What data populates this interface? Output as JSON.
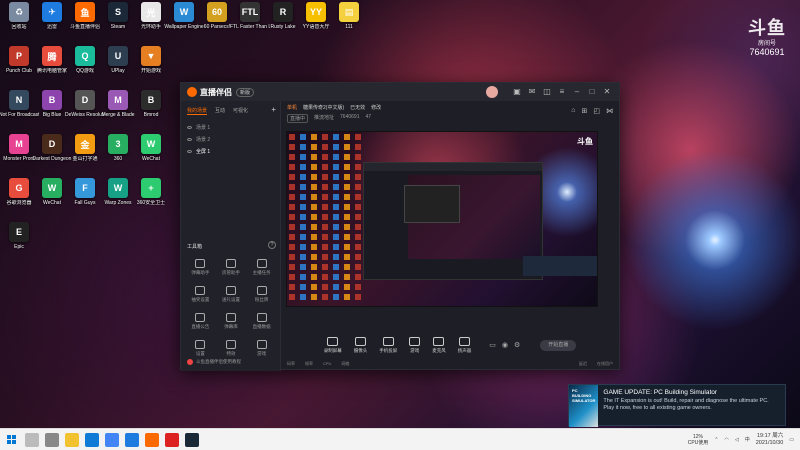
{
  "desktop_icons": [
    {
      "label": "回收站",
      "color": "#7a8aa0",
      "glyph": "♻"
    },
    {
      "label": "迅雷",
      "color": "#1e7be0",
      "glyph": "✈"
    },
    {
      "label": "斗鱼直播伴侣",
      "color": "#ff6a00",
      "glyph": "鱼"
    },
    {
      "label": "Steam",
      "color": "#1b2838",
      "glyph": "S"
    },
    {
      "label": "光环助手",
      "color": "#e8e8e8",
      "glyph": "光"
    },
    {
      "label": "Wallpaper Engine",
      "color": "#2a8ad4",
      "glyph": "W"
    },
    {
      "label": "60 Parsecs!",
      "color": "#d4a020",
      "glyph": "60"
    },
    {
      "label": "FTL Faster Than Light",
      "color": "#333",
      "glyph": "FTL"
    },
    {
      "label": "Rusty Lake",
      "color": "#222",
      "glyph": "R"
    },
    {
      "label": "YY语音大厅",
      "color": "#f6c000",
      "glyph": "YY"
    },
    {
      "label": "111",
      "color": "#f4d03f",
      "glyph": "▤"
    },
    {
      "label": "Punch Club",
      "color": "#c0392b",
      "glyph": "P"
    },
    {
      "label": "腾讯电脑管家",
      "color": "#e74c3c",
      "glyph": "腾"
    },
    {
      "label": "QQ游戏",
      "color": "#1abc9c",
      "glyph": "Q"
    },
    {
      "label": "UPlay",
      "color": "#2c3e50",
      "glyph": "U"
    },
    {
      "label": "开始游戏",
      "color": "#e67e22",
      "glyph": "▼"
    },
    {
      "label": "Not For Broadcast",
      "color": "#34495e",
      "glyph": "N"
    },
    {
      "label": "Big Blue",
      "color": "#8e44ad",
      "glyph": "B"
    },
    {
      "label": "DeWeiss Resolution",
      "color": "#555",
      "glyph": "D"
    },
    {
      "label": "Merge & Blade",
      "color": "#9b59b6",
      "glyph": "M"
    },
    {
      "label": "Bmrod",
      "color": "#2c2c2c",
      "glyph": "B"
    },
    {
      "label": "Monster Prom",
      "color": "#e84393",
      "glyph": "M"
    },
    {
      "label": "Darkest Dungeon",
      "color": "#4a2a1a",
      "glyph": "D"
    },
    {
      "label": "金山打字通",
      "color": "#f39c12",
      "glyph": "金"
    },
    {
      "label": "360",
      "color": "#27ae60",
      "glyph": "3"
    },
    {
      "label": "WeChat",
      "color": "#2ecc71",
      "glyph": "W"
    },
    {
      "label": "谷歌浏览器",
      "color": "#e74c3c",
      "glyph": "G"
    },
    {
      "label": "WeChat",
      "color": "#27ae60",
      "glyph": "W"
    },
    {
      "label": "Fall Guys",
      "color": "#3498db",
      "glyph": "F"
    },
    {
      "label": "Warp Zones",
      "color": "#16a085",
      "glyph": "W"
    },
    {
      "label": "360安全卫士",
      "color": "#2ecc71",
      "glyph": "+"
    },
    {
      "label": "Epic",
      "color": "#222",
      "glyph": "E"
    }
  ],
  "watermark": {
    "logo": "斗鱼",
    "subtitle": "房间号",
    "room_id": "7640691"
  },
  "app": {
    "name": "直播伴侣",
    "badge": "新版",
    "left_tabs": [
      "我的场景",
      "互动",
      "可视化"
    ],
    "scenes": [
      "场景 1",
      "场景 2",
      "全屏 1"
    ],
    "tools_header": "工具箱",
    "tools": [
      "弹幕助手",
      "房管助手",
      "主播任务",
      "抽奖设置",
      "送礼设置",
      "粉丝牌",
      "直播公告",
      "弹幕库",
      "直播数据",
      "设置",
      "特效",
      "游戏"
    ],
    "live_notice": "斗鱼直播伴侣使用教程",
    "info": {
      "category": "单机",
      "title": "糖果传奇2(中文版)",
      "status": "已无效",
      "tag": "修改",
      "pill1": "直播中",
      "pill2": "推流地址",
      "room": "7640691",
      "fans": "47"
    },
    "controls": [
      "录制屏幕",
      "摄像头",
      "手机投屏",
      "游戏",
      "麦克风",
      "扬声器"
    ],
    "start_label": "开始直播",
    "stats": [
      "码率",
      "帧率",
      "CPU",
      "网络",
      "延迟",
      "在线用户"
    ]
  },
  "steam_popup": {
    "image_text": "PC BUILDING SIMULATOR",
    "title": "GAME UPDATE: PC Building Simulator",
    "body": "The IT Expansion is out! Build, repair and diagnose the ultimate PC. Play it now, free to all existing game owners."
  },
  "taskbar": {
    "apps": [
      {
        "name": "search",
        "color": "#bbb"
      },
      {
        "name": "task-view",
        "color": "#888"
      },
      {
        "name": "file-explorer",
        "color": "#f2c230"
      },
      {
        "name": "edge",
        "color": "#0f7bd6"
      },
      {
        "name": "chrome",
        "color": "#4285f4"
      },
      {
        "name": "thunder",
        "color": "#1e7be0"
      },
      {
        "name": "douyu",
        "color": "#ff6a00"
      },
      {
        "name": "netease",
        "color": "#d22"
      },
      {
        "name": "steam",
        "color": "#1b2838"
      }
    ],
    "cpu_value": "12%",
    "cpu_label": "CPU使用",
    "time": "19:17 周六",
    "date": "2021/10/30"
  }
}
